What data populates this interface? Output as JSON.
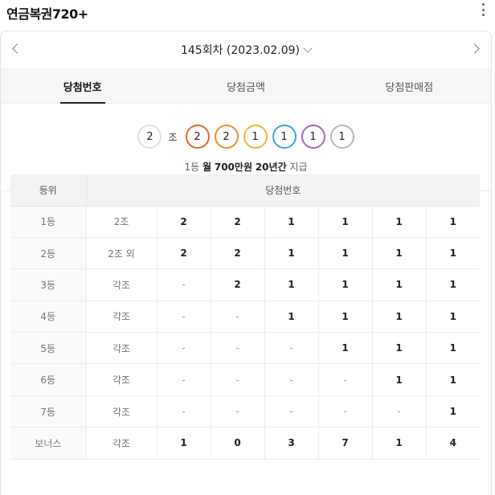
{
  "app": {
    "title": "연금복권720+"
  },
  "round": {
    "label": "145회차 (2023.02.09)"
  },
  "tabs": [
    {
      "label": "당첨번호",
      "active": true
    },
    {
      "label": "당첨금액",
      "active": false
    },
    {
      "label": "당첨판매점",
      "active": false
    }
  ],
  "winning": {
    "group": "2",
    "group_suffix": "조",
    "digits": [
      "2",
      "2",
      "1",
      "1",
      "1",
      "1"
    ],
    "ball_colors": [
      "#e0e0e0",
      "#e8672c",
      "#e8942c",
      "#f2b632",
      "#3aa6dc",
      "#9a6fc7",
      "#b9b9b9"
    ]
  },
  "prize": {
    "rank": "1등",
    "amount_prefix": "월",
    "amount": "700만원",
    "period": "20년간",
    "suffix": "지급"
  },
  "table": {
    "headers": {
      "rank": "등위",
      "numbers": "당첨번호"
    },
    "rows": [
      {
        "rank": "1등",
        "group": "2조",
        "digits": [
          "2",
          "2",
          "1",
          "1",
          "1",
          "1"
        ]
      },
      {
        "rank": "2등",
        "group": "2조 외",
        "digits": [
          "2",
          "2",
          "1",
          "1",
          "1",
          "1"
        ]
      },
      {
        "rank": "3등",
        "group": "각조",
        "digits": [
          "-",
          "2",
          "1",
          "1",
          "1",
          "1"
        ]
      },
      {
        "rank": "4등",
        "group": "각조",
        "digits": [
          "-",
          "-",
          "1",
          "1",
          "1",
          "1"
        ]
      },
      {
        "rank": "5등",
        "group": "각조",
        "digits": [
          "-",
          "-",
          "-",
          "1",
          "1",
          "1"
        ]
      },
      {
        "rank": "6등",
        "group": "각조",
        "digits": [
          "-",
          "-",
          "-",
          "-",
          "1",
          "1"
        ]
      },
      {
        "rank": "7등",
        "group": "각조",
        "digits": [
          "-",
          "-",
          "-",
          "-",
          "-",
          "1"
        ]
      },
      {
        "rank": "보너스",
        "group": "각조",
        "digits": [
          "1",
          "0",
          "3",
          "7",
          "1",
          "4"
        ]
      }
    ]
  }
}
